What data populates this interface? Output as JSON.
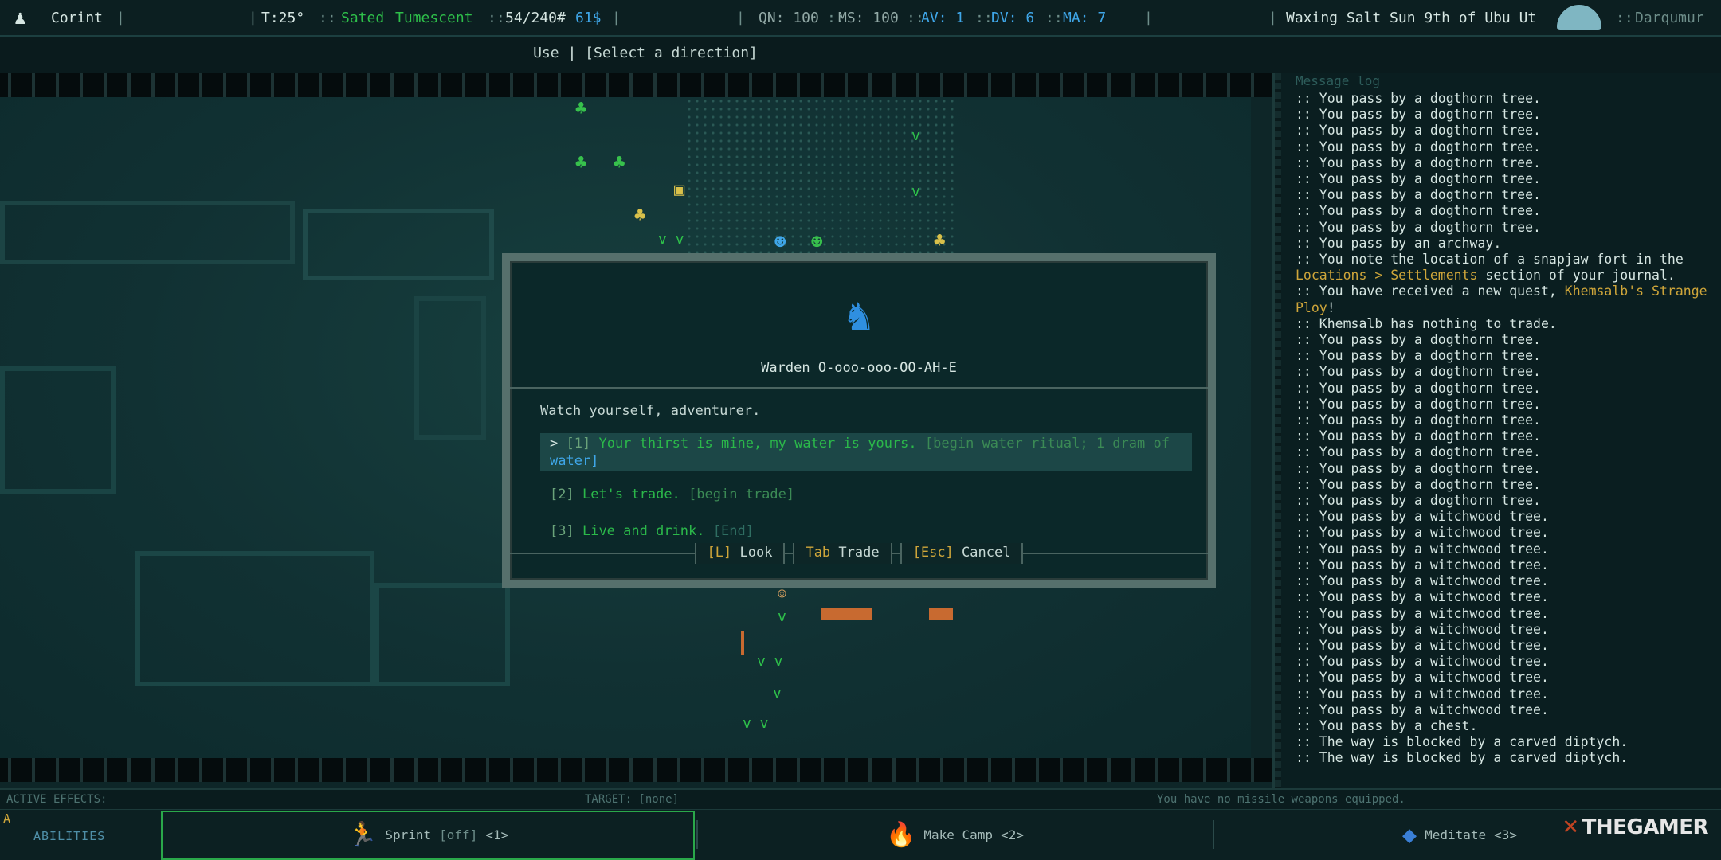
{
  "topbar": {
    "player_name": "Corint",
    "temperature": "T:25°",
    "status_1": "Sated",
    "status_2": "Tumescent",
    "weight": "54/240#",
    "money": "61$",
    "qn": "QN: 100",
    "ms": "MS: 100",
    "av": "AV: 1",
    "dv": "DV: 6",
    "ma": "MA: 7",
    "date": "Waxing Salt Sun 9th of Ubu Ut",
    "location": "Darqumur"
  },
  "command": {
    "verb": "Use",
    "prompt": "[Select a direction]"
  },
  "dialog": {
    "speaker": "Warden O-ooo-ooo-OO-AH-E",
    "speech": "Watch yourself, adventurer.",
    "options": [
      {
        "num": "[1]",
        "text": "Your thirst is mine, my water is yours.",
        "action": "[begin water ritual; 1 dram of",
        "action_cont": "water]"
      },
      {
        "num": "[2]",
        "text": "Let's trade.",
        "action": "[begin trade]"
      },
      {
        "num": "[3]",
        "text": "Live and drink.",
        "action": "[End]"
      }
    ],
    "footer": {
      "look_key": "[L]",
      "look_label": "Look",
      "trade_key": "Tab",
      "trade_label": "Trade",
      "cancel_key": "[Esc]",
      "cancel_label": "Cancel"
    }
  },
  "log": {
    "title": "Message log",
    "lines_a": [
      ":: You pass by a dogthorn tree.",
      ":: You pass by a dogthorn tree.",
      ":: You pass by a dogthorn tree.",
      ":: You pass by a dogthorn tree.",
      ":: You pass by a dogthorn tree.",
      ":: You pass by a dogthorn tree.",
      ":: You pass by a dogthorn tree.",
      ":: You pass by a dogthorn tree.",
      ":: You pass by a dogthorn tree.",
      ":: You pass by an archway."
    ],
    "note_prefix": ":: You note the location of a snapjaw fort in the ",
    "note_link": "Locations > Settlements",
    "note_suffix": " section of your journal.",
    "quest_prefix": ":: You have received a new quest, ",
    "quest_link": "Khemsalb's Strange Ploy",
    "quest_suffix": "!",
    "lines_b": [
      ":: Khemsalb has nothing to trade.",
      ":: You pass by a dogthorn tree.",
      ":: You pass by a dogthorn tree.",
      ":: You pass by a dogthorn tree.",
      ":: You pass by a dogthorn tree.",
      ":: You pass by a dogthorn tree.",
      ":: You pass by a dogthorn tree.",
      ":: You pass by a dogthorn tree.",
      ":: You pass by a dogthorn tree.",
      ":: You pass by a dogthorn tree.",
      ":: You pass by a dogthorn tree.",
      ":: You pass by a dogthorn tree.",
      ":: You pass by a witchwood tree.",
      ":: You pass by a witchwood tree.",
      ":: You pass by a witchwood tree.",
      ":: You pass by a witchwood tree.",
      ":: You pass by a witchwood tree.",
      ":: You pass by a witchwood tree.",
      ":: You pass by a witchwood tree.",
      ":: You pass by a witchwood tree.",
      ":: You pass by a witchwood tree.",
      ":: You pass by a witchwood tree.",
      ":: You pass by a witchwood tree.",
      ":: You pass by a witchwood tree.",
      ":: You pass by a witchwood tree.",
      ":: You pass by a chest.",
      ":: The way is blocked by a carved diptych.",
      ":: The way is blocked by a carved diptych."
    ]
  },
  "effects": {
    "active": "ACTIVE EFFECTS:",
    "target": "TARGET: [none]",
    "missile": "You have no missile weapons equipped."
  },
  "abilities": {
    "label": "ABILITIES",
    "cursor": "A",
    "sprint_name": "Sprint",
    "sprint_state": "[off]",
    "sprint_key": "<1>",
    "camp_name": "Make Camp",
    "camp_key": "<2>",
    "meditate_name": "Meditate",
    "meditate_key": "<3>"
  },
  "watermark": "THEGAMER",
  "icons": {
    "player": "player-icon",
    "location": "world-map-icon",
    "portrait": "warden-portrait-icon"
  }
}
